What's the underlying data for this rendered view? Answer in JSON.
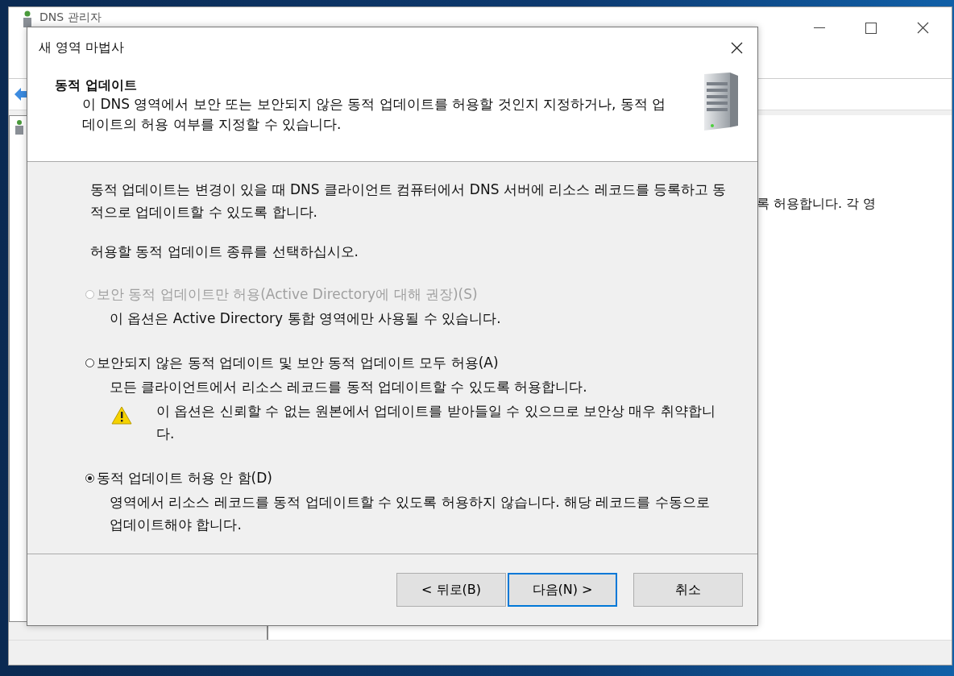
{
  "background_window": {
    "title": "DNS 관리자",
    "pane_text": "록 허용합니다. 각 영"
  },
  "dialog": {
    "title": "새 영역 마법사",
    "header": {
      "title": "동적 업데이트",
      "description": "이 DNS 영역에서 보안 또는 보안되지 않은 동적 업데이트를 허용할 것인지 지정하거나, 동적 업데이트의 허용 여부를 지정할 수 있습니다."
    },
    "intro": "동적 업데이트는 변경이 있을 때 DNS 클라이언트 컴퓨터에서 DNS 서버에 리소스 레코드를 등록하고 동적으로 업데이트할 수 있도록 합니다.",
    "prompt": "허용할 동적 업데이트 종류를 선택하십시오.",
    "options": [
      {
        "label": "보안 동적 업데이트만 허용(Active Directory에 대해 권장)(S)",
        "description": "이 옵션은 Active Directory 통합 영역에만 사용될 수 있습니다.",
        "selected": false,
        "disabled": true
      },
      {
        "label": "보안되지 않은 동적 업데이트 및 보안 동적 업데이트 모두 허용(A)",
        "description": "모든 클라이언트에서 리소스 레코드를 동적 업데이트할 수 있도록 허용합니다.",
        "warning": "이 옵션은 신뢰할 수 없는 원본에서 업데이트를 받아들일 수 있으므로 보안상 매우 취약합니다.",
        "selected": false,
        "disabled": false
      },
      {
        "label": "동적 업데이트 허용 안 함(D)",
        "description": "영역에서 리소스 레코드를 동적 업데이트할 수 있도록 허용하지 않습니다. 해당 레코드를 수동으로 업데이트해야 합니다.",
        "selected": true,
        "disabled": false
      }
    ],
    "buttons": [
      {
        "label": "< 뒤로(B)",
        "focused": false
      },
      {
        "label": "다음(N) >",
        "focused": true
      },
      {
        "label": "취소",
        "focused": false
      }
    ]
  }
}
